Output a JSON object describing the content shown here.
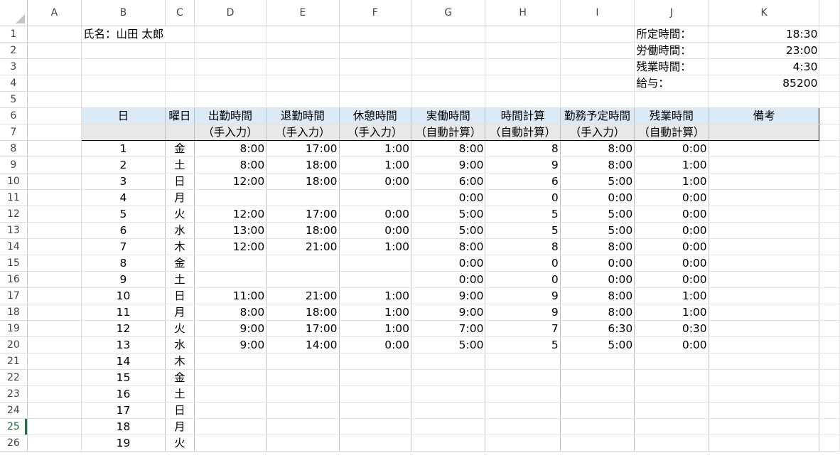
{
  "columns": [
    "A",
    "B",
    "C",
    "D",
    "E",
    "F",
    "G",
    "H",
    "I",
    "J",
    "K"
  ],
  "name_label": "氏名：山田 太郎",
  "summary": [
    {
      "label": "所定時間：",
      "value": "18:30"
    },
    {
      "label": "労働時間：",
      "value": "23:00"
    },
    {
      "label": "残業時間：",
      "value": "4:30"
    },
    {
      "label": "給与：",
      "value": "85200"
    }
  ],
  "headers_row6": [
    "日",
    "曜日",
    "出勤時間",
    "退勤時間",
    "休憩時間",
    "実働時間",
    "時間計算",
    "勤務予定時間",
    "残業時間",
    "備考"
  ],
  "headers_row7": [
    "",
    "",
    "（手入力）",
    "（手入力）",
    "（手入力）",
    "（自動計算）",
    "（自動計算）",
    "（手入力）",
    "（自動計算）",
    ""
  ],
  "selected_row": 25,
  "rows": [
    {
      "r": 8,
      "day": "1",
      "wd": "金",
      "in": "8:00",
      "out": "17:00",
      "brk": "1:00",
      "work": "8:00",
      "calc": "8",
      "plan": "8:00",
      "ot": "0:00"
    },
    {
      "r": 9,
      "day": "2",
      "wd": "土",
      "in": "8:00",
      "out": "18:00",
      "brk": "1:00",
      "work": "9:00",
      "calc": "9",
      "plan": "8:00",
      "ot": "1:00"
    },
    {
      "r": 10,
      "day": "3",
      "wd": "日",
      "in": "12:00",
      "out": "18:00",
      "brk": "0:00",
      "work": "6:00",
      "calc": "6",
      "plan": "5:00",
      "ot": "1:00"
    },
    {
      "r": 11,
      "day": "4",
      "wd": "月",
      "in": "",
      "out": "",
      "brk": "",
      "work": "0:00",
      "calc": "0",
      "plan": "0:00",
      "ot": "0:00"
    },
    {
      "r": 12,
      "day": "5",
      "wd": "火",
      "in": "12:00",
      "out": "17:00",
      "brk": "0:00",
      "work": "5:00",
      "calc": "5",
      "plan": "5:00",
      "ot": "0:00"
    },
    {
      "r": 13,
      "day": "6",
      "wd": "水",
      "in": "13:00",
      "out": "18:00",
      "brk": "0:00",
      "work": "5:00",
      "calc": "5",
      "plan": "5:00",
      "ot": "0:00"
    },
    {
      "r": 14,
      "day": "7",
      "wd": "木",
      "in": "12:00",
      "out": "21:00",
      "brk": "1:00",
      "work": "8:00",
      "calc": "8",
      "plan": "8:00",
      "ot": "0:00"
    },
    {
      "r": 15,
      "day": "8",
      "wd": "金",
      "in": "",
      "out": "",
      "brk": "",
      "work": "0:00",
      "calc": "0",
      "plan": "0:00",
      "ot": "0:00"
    },
    {
      "r": 16,
      "day": "9",
      "wd": "土",
      "in": "",
      "out": "",
      "brk": "",
      "work": "0:00",
      "calc": "0",
      "plan": "0:00",
      "ot": "0:00"
    },
    {
      "r": 17,
      "day": "10",
      "wd": "日",
      "in": "11:00",
      "out": "21:00",
      "brk": "1:00",
      "work": "9:00",
      "calc": "9",
      "plan": "8:00",
      "ot": "1:00"
    },
    {
      "r": 18,
      "day": "11",
      "wd": "月",
      "in": "8:00",
      "out": "18:00",
      "brk": "1:00",
      "work": "9:00",
      "calc": "9",
      "plan": "8:00",
      "ot": "1:00"
    },
    {
      "r": 19,
      "day": "12",
      "wd": "火",
      "in": "9:00",
      "out": "17:00",
      "brk": "1:00",
      "work": "7:00",
      "calc": "7",
      "plan": "6:30",
      "ot": "0:30"
    },
    {
      "r": 20,
      "day": "13",
      "wd": "水",
      "in": "9:00",
      "out": "14:00",
      "brk": "0:00",
      "work": "5:00",
      "calc": "5",
      "plan": "5:00",
      "ot": "0:00"
    },
    {
      "r": 21,
      "day": "14",
      "wd": "木",
      "in": "",
      "out": "",
      "brk": "",
      "work": "",
      "calc": "",
      "plan": "",
      "ot": ""
    },
    {
      "r": 22,
      "day": "15",
      "wd": "金",
      "in": "",
      "out": "",
      "brk": "",
      "work": "",
      "calc": "",
      "plan": "",
      "ot": ""
    },
    {
      "r": 23,
      "day": "16",
      "wd": "土",
      "in": "",
      "out": "",
      "brk": "",
      "work": "",
      "calc": "",
      "plan": "",
      "ot": ""
    },
    {
      "r": 24,
      "day": "17",
      "wd": "日",
      "in": "",
      "out": "",
      "brk": "",
      "work": "",
      "calc": "",
      "plan": "",
      "ot": ""
    },
    {
      "r": 25,
      "day": "18",
      "wd": "月",
      "in": "",
      "out": "",
      "brk": "",
      "work": "",
      "calc": "",
      "plan": "",
      "ot": ""
    },
    {
      "r": 26,
      "day": "19",
      "wd": "火",
      "in": "",
      "out": "",
      "brk": "",
      "work": "",
      "calc": "",
      "plan": "",
      "ot": ""
    }
  ]
}
